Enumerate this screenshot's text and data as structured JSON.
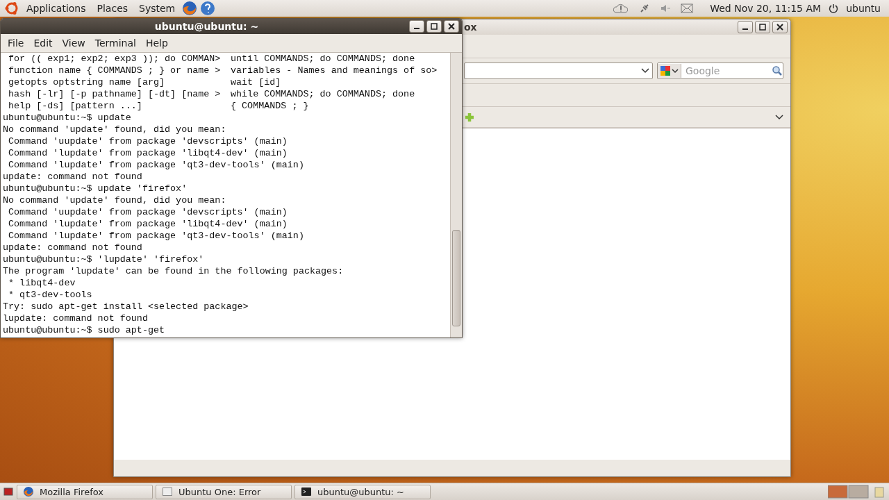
{
  "top_panel": {
    "menus": [
      "Applications",
      "Places",
      "System"
    ],
    "clock": "Wed Nov 20, 11:15 AM",
    "user": "ubuntu"
  },
  "firefox": {
    "title": "ox",
    "search": {
      "placeholder": "Google"
    }
  },
  "terminal": {
    "title": "ubuntu@ubuntu: ~",
    "menus": [
      "File",
      "Edit",
      "View",
      "Terminal",
      "Help"
    ],
    "lines": [
      {
        "kind": "columns",
        "left": " for (( exp1; exp2; exp3 )); do COMMAN>",
        "right": "until COMMANDS; do COMMANDS; done"
      },
      {
        "kind": "columns",
        "left": " function name { COMMANDS ; } or name >",
        "right": "variables - Names and meanings of so>"
      },
      {
        "kind": "columns",
        "left": " getopts optstring name [arg]",
        "right": "wait [id]"
      },
      {
        "kind": "columns",
        "left": " hash [-lr] [-p pathname] [-dt] [name >",
        "right": "while COMMANDS; do COMMANDS; done"
      },
      {
        "kind": "columns",
        "left": " help [-ds] [pattern ...]",
        "right": "{ COMMANDS ; }"
      },
      {
        "kind": "text",
        "text": "ubuntu@ubuntu:~$ update"
      },
      {
        "kind": "text",
        "text": "No command 'update' found, did you mean:"
      },
      {
        "kind": "text",
        "text": " Command 'uupdate' from package 'devscripts' (main)"
      },
      {
        "kind": "text",
        "text": " Command 'lupdate' from package 'libqt4-dev' (main)"
      },
      {
        "kind": "text",
        "text": " Command 'lupdate' from package 'qt3-dev-tools' (main)"
      },
      {
        "kind": "text",
        "text": "update: command not found"
      },
      {
        "kind": "text",
        "text": "ubuntu@ubuntu:~$ update 'firefox'"
      },
      {
        "kind": "text",
        "text": "No command 'update' found, did you mean:"
      },
      {
        "kind": "text",
        "text": " Command 'uupdate' from package 'devscripts' (main)"
      },
      {
        "kind": "text",
        "text": " Command 'lupdate' from package 'libqt4-dev' (main)"
      },
      {
        "kind": "text",
        "text": " Command 'lupdate' from package 'qt3-dev-tools' (main)"
      },
      {
        "kind": "text",
        "text": "update: command not found"
      },
      {
        "kind": "text",
        "text": "ubuntu@ubuntu:~$ 'lupdate' 'firefox'"
      },
      {
        "kind": "text",
        "text": "The program 'lupdate' can be found in the following packages:"
      },
      {
        "kind": "text",
        "text": " * libqt4-dev"
      },
      {
        "kind": "text",
        "text": " * qt3-dev-tools"
      },
      {
        "kind": "text",
        "text": "Try: sudo apt-get install <selected package>"
      },
      {
        "kind": "text",
        "text": "lupdate: command not found"
      },
      {
        "kind": "text",
        "text": "ubuntu@ubuntu:~$ sudo apt-get"
      }
    ]
  },
  "taskbar": [
    {
      "label": "Mozilla Firefox"
    },
    {
      "label": "Ubuntu One: Error"
    },
    {
      "label": "ubuntu@ubuntu: ~"
    }
  ]
}
